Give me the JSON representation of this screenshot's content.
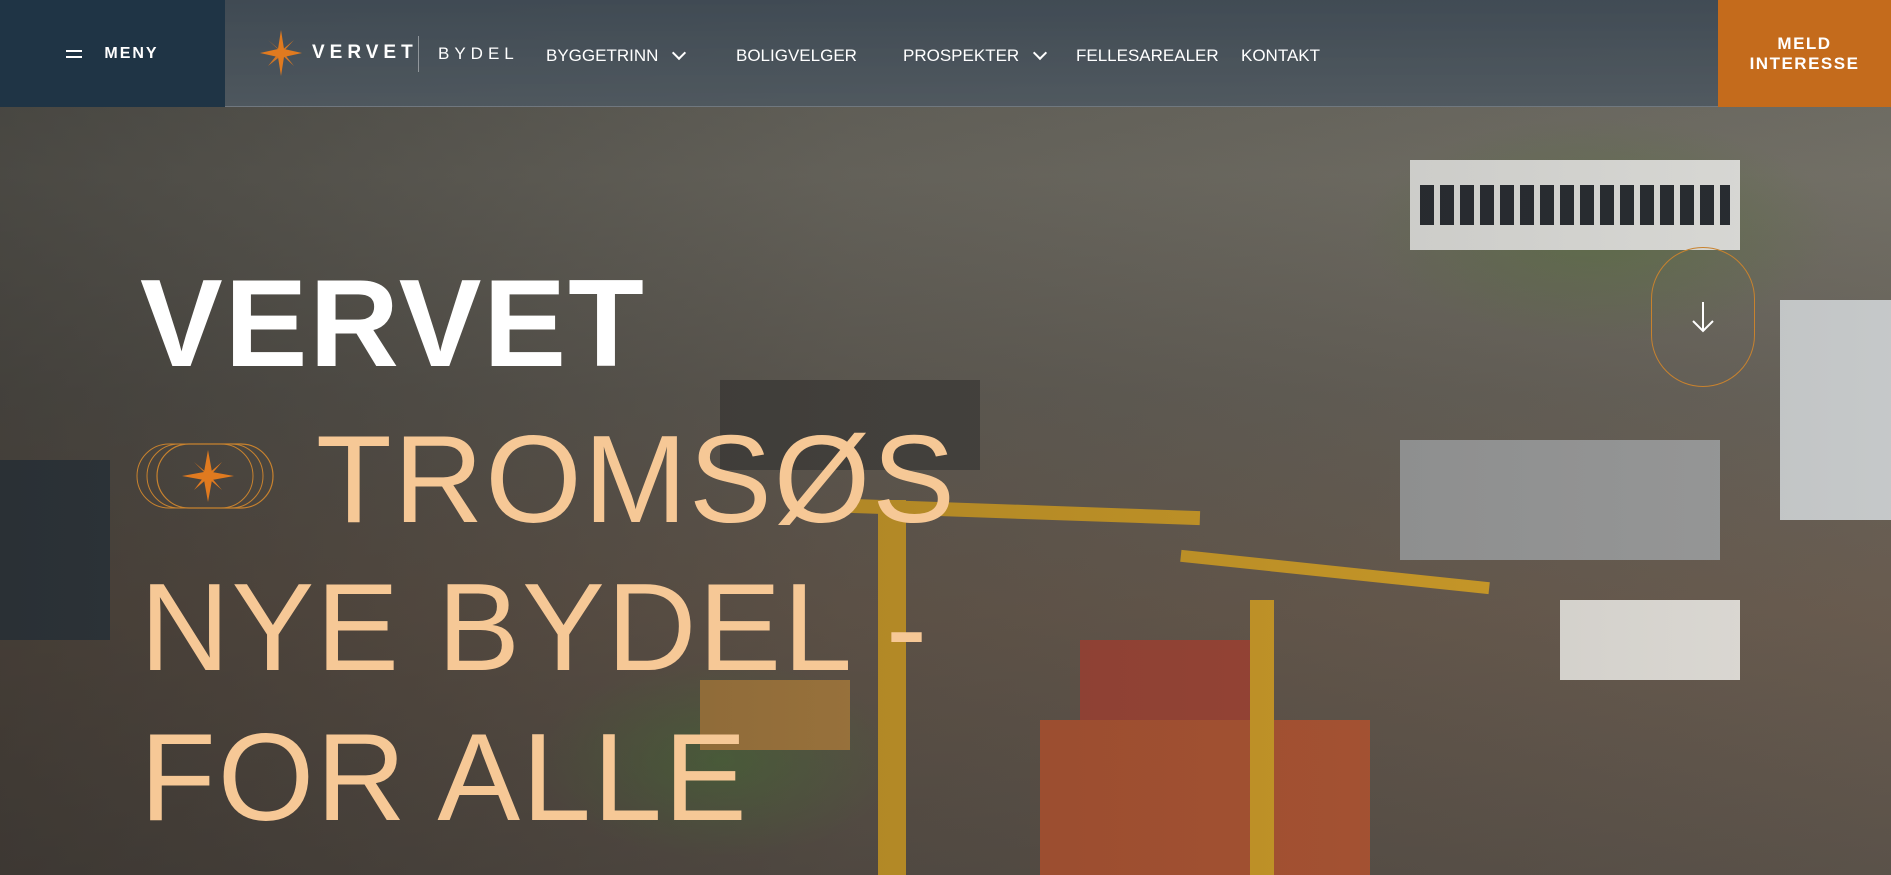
{
  "header": {
    "menu_label": "MENY",
    "logo_text": "VERVET",
    "logo_sub": "BYDEL",
    "nav": [
      {
        "label": "BYGGETRINN",
        "has_dropdown": true
      },
      {
        "label": "BOLIGVELGER",
        "has_dropdown": false
      },
      {
        "label": "PROSPEKTER",
        "has_dropdown": true
      },
      {
        "label": "FELLESAREALER",
        "has_dropdown": false
      },
      {
        "label": "KONTAKT",
        "has_dropdown": false
      }
    ],
    "cta_line1": "MELD",
    "cta_line2": "INTERESSE"
  },
  "hero": {
    "title": "VERVET",
    "line1": "TROMSØS",
    "line2": "NYE BYDEL -",
    "line3": "FOR ALLE"
  },
  "icons": {
    "menu": "hamburger-icon",
    "logo": "star-icon",
    "dropdown": "chevron-down-icon",
    "scroll": "arrow-down-icon"
  },
  "colors": {
    "accent": "#c46b1c",
    "menu_bg": "#1f3445",
    "hero_highlight": "#f6c896"
  }
}
